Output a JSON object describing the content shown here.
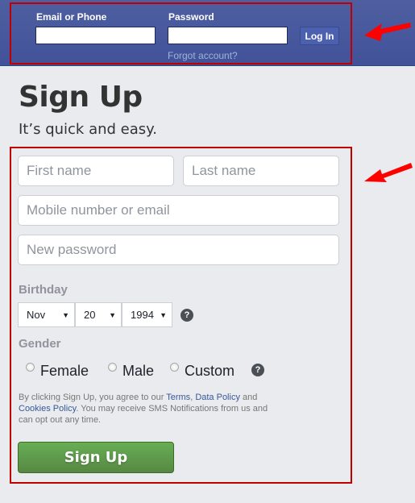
{
  "header": {
    "email_label": "Email or Phone",
    "email_value": "",
    "password_label": "Password",
    "password_value": "",
    "login_label": "Log In",
    "forgot_label": "Forgot account?"
  },
  "signup": {
    "title": "Sign Up",
    "subtitle": "It’s quick and easy.",
    "first_name_placeholder": "First name",
    "last_name_placeholder": "Last name",
    "contact_placeholder": "Mobile number or email",
    "password_placeholder": "New password",
    "birthday_label": "Birthday",
    "birthday": {
      "month": "Nov",
      "day": "20",
      "year": "1994"
    },
    "gender_label": "Gender",
    "gender_options": [
      "Female",
      "Male",
      "Custom"
    ],
    "help_glyph": "?",
    "caret_glyph": "▼",
    "terms": {
      "prefix": "By clicking Sign Up, you agree to our ",
      "terms_link": "Terms",
      "sep": ", ",
      "data_policy_link": "Data Policy",
      "and": " and ",
      "cookies_link": "Cookies Policy",
      "suffix": ". You may receive SMS Notifications from us and can opt out any time."
    },
    "submit_label": "Sign Up"
  },
  "annotations": {
    "color": "#ff0000",
    "box_color": "#c00000"
  }
}
